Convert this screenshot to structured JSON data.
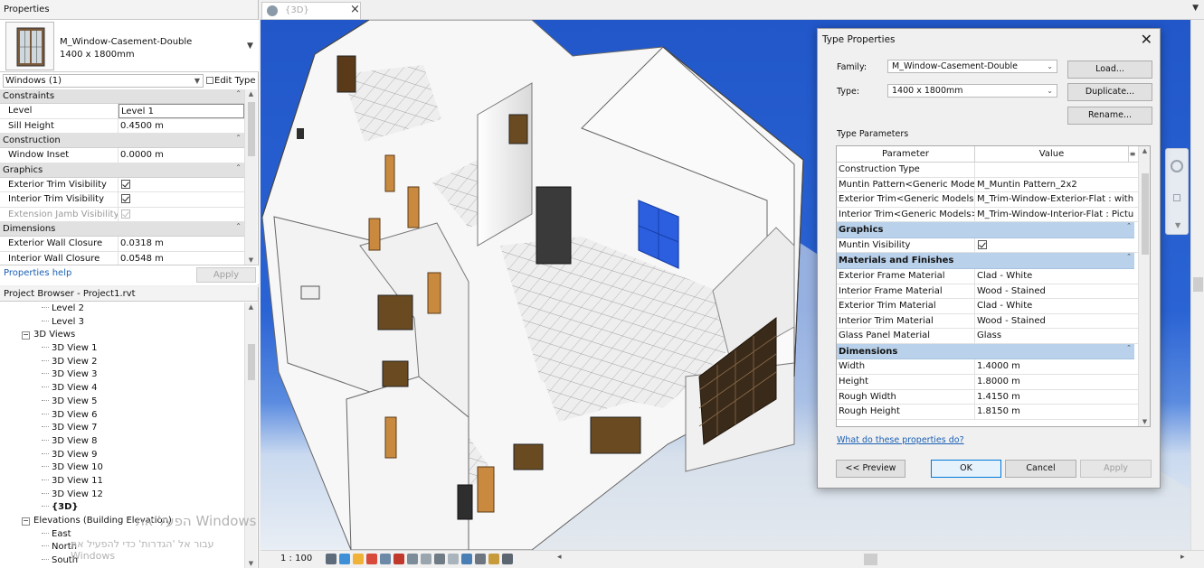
{
  "properties": {
    "panel_title": "Properties",
    "type_name": "M_Window-Casement-Double",
    "type_size": "1400 x 1800mm",
    "instance_filter": "Windows (1)",
    "edit_type": "Edit Type",
    "groups": [
      {
        "name": "Constraints",
        "rows": [
          {
            "label": "Level",
            "value": "Level 1"
          },
          {
            "label": "Sill Height",
            "value": "0.4500 m"
          }
        ]
      },
      {
        "name": "Construction",
        "rows": [
          {
            "label": "Window Inset",
            "value": "0.0000 m"
          }
        ]
      },
      {
        "name": "Graphics",
        "rows": [
          {
            "label": "Exterior Trim Visibility",
            "checked": true
          },
          {
            "label": "Interior Trim Visibility",
            "checked": true
          },
          {
            "label": "Extension Jamb Visibility",
            "checked": true,
            "disabled": true
          }
        ]
      },
      {
        "name": "Dimensions",
        "rows": [
          {
            "label": "Exterior Wall Closure",
            "value": "0.0318 m"
          },
          {
            "label": "Interior Wall Closure",
            "value": "0.0548 m"
          }
        ]
      }
    ],
    "help_link": "Properties help",
    "apply": "Apply"
  },
  "browser": {
    "title": "Project Browser - Project1.rvt",
    "items": [
      {
        "label": "Level 2",
        "indent": 3
      },
      {
        "label": "Level 3",
        "indent": 3
      },
      {
        "label": "3D Views",
        "indent": 1,
        "expander": "−"
      },
      {
        "label": "3D View 1",
        "indent": 3
      },
      {
        "label": "3D View 2",
        "indent": 3
      },
      {
        "label": "3D View 3",
        "indent": 3
      },
      {
        "label": "3D View 4",
        "indent": 3
      },
      {
        "label": "3D View 5",
        "indent": 3
      },
      {
        "label": "3D View 6",
        "indent": 3
      },
      {
        "label": "3D View 7",
        "indent": 3
      },
      {
        "label": "3D View 8",
        "indent": 3
      },
      {
        "label": "3D View 9",
        "indent": 3
      },
      {
        "label": "3D View 10",
        "indent": 3
      },
      {
        "label": "3D View 11",
        "indent": 3
      },
      {
        "label": "3D View 12",
        "indent": 3
      },
      {
        "label": "{3D}",
        "indent": 3,
        "bold": true
      },
      {
        "label": "Elevations (Building Elevation)",
        "indent": 1,
        "expander": "−"
      },
      {
        "label": "East",
        "indent": 3
      },
      {
        "label": "North",
        "indent": 3
      },
      {
        "label": "South",
        "indent": 3
      }
    ],
    "watermark_line1": "הפעל את Windows",
    "watermark_line2": "עבור אל 'הגדרות' כדי להפעיל את Windows"
  },
  "view": {
    "tab_label": "{3D}",
    "scale": "1 : 100"
  },
  "dialog": {
    "title": "Type Properties",
    "family_label": "Family:",
    "family_value": "M_Window-Casement-Double",
    "type_label": "Type:",
    "type_value": "1400 x 1800mm",
    "load": "Load...",
    "duplicate": "Duplicate...",
    "rename": "Rename...",
    "type_parameters": "Type Parameters",
    "col_parameter": "Parameter",
    "col_value": "Value",
    "rows_top": [
      {
        "param": "Construction Type",
        "value": ""
      },
      {
        "param": "Muntin Pattern<Generic Models",
        "value": "M_Muntin Pattern_2x2"
      },
      {
        "param": "Exterior Trim<Generic Models>",
        "value": "M_Trim-Window-Exterior-Flat : with"
      },
      {
        "param": "Interior Trim<Generic Models>",
        "value": "M_Trim-Window-Interior-Flat : Pictu"
      }
    ],
    "graphics_group": "Graphics",
    "graphics_rows": [
      {
        "param": "Muntin Visibility",
        "checked": true
      }
    ],
    "materials_group": "Materials and Finishes",
    "materials_rows": [
      {
        "param": "Exterior Frame Material",
        "value": "Clad - White"
      },
      {
        "param": "Interior Frame Material",
        "value": "Wood - Stained"
      },
      {
        "param": "Exterior Trim Material",
        "value": "Clad - White"
      },
      {
        "param": "Interior Trim Material",
        "value": "Wood - Stained"
      },
      {
        "param": "Glass Panel Material",
        "value": "Glass"
      }
    ],
    "dimensions_group": "Dimensions",
    "dimensions_rows": [
      {
        "param": "Width",
        "value": "1.4000 m"
      },
      {
        "param": "Height",
        "value": "1.8000 m"
      },
      {
        "param": "Rough Width",
        "value": "1.4150 m"
      },
      {
        "param": "Rough Height",
        "value": "1.8150 m"
      }
    ],
    "help_link": "What do these properties do?",
    "preview": "<< Preview",
    "ok": "OK",
    "cancel": "Cancel",
    "apply": "Apply"
  },
  "icons": {
    "close": "close-icon",
    "view_cube": "viewcube-icon",
    "window_thumb": "window-thumbnail-icon"
  },
  "colors": {
    "sky": "#2157c9",
    "group_header": "#b9d1ea",
    "selected_window": "#2c5fe0",
    "link": "#1a5fb4"
  }
}
